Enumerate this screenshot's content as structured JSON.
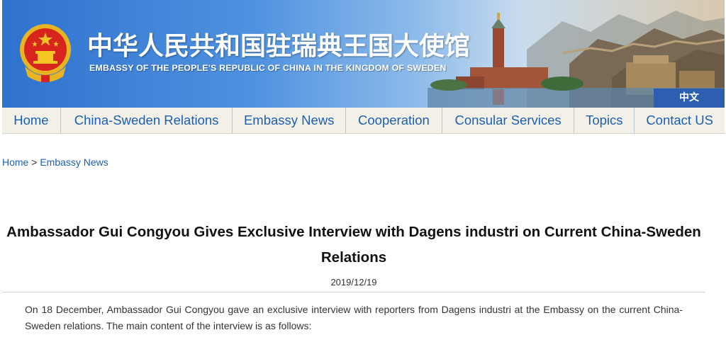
{
  "header": {
    "title_cn": "中华人民共和国驻瑞典王国大使馆",
    "title_en": "EMBASSY OF THE PEOPLE'S REPUBLIC OF CHINA IN THE KINGDOM OF SWEDEN",
    "language_switch": "中文",
    "emblem_icon": "national-emblem-icon"
  },
  "nav": {
    "items": [
      {
        "label": "Home"
      },
      {
        "label": "China-Sweden Relations"
      },
      {
        "label": "Embassy News"
      },
      {
        "label": "Cooperation"
      },
      {
        "label": "Consular Services"
      },
      {
        "label": "Topics"
      },
      {
        "label": "Contact US"
      }
    ]
  },
  "breadcrumb": {
    "home": "Home",
    "separator": " > ",
    "current": "Embassy News"
  },
  "article": {
    "title": "Ambassador Gui Congyou Gives Exclusive Interview with Dagens industri on Current China-Sweden Relations",
    "date": "2019/12/19",
    "body": "On 18 December, Ambassador Gui Congyou gave an exclusive interview with reporters from Dagens industri at the Embassy on the current China-Sweden relations. The main content of the interview is as follows:"
  },
  "colors": {
    "link": "#1b5fb4",
    "banner_blue": "#2f72cf",
    "nav_bg": "#f3f1e7"
  }
}
